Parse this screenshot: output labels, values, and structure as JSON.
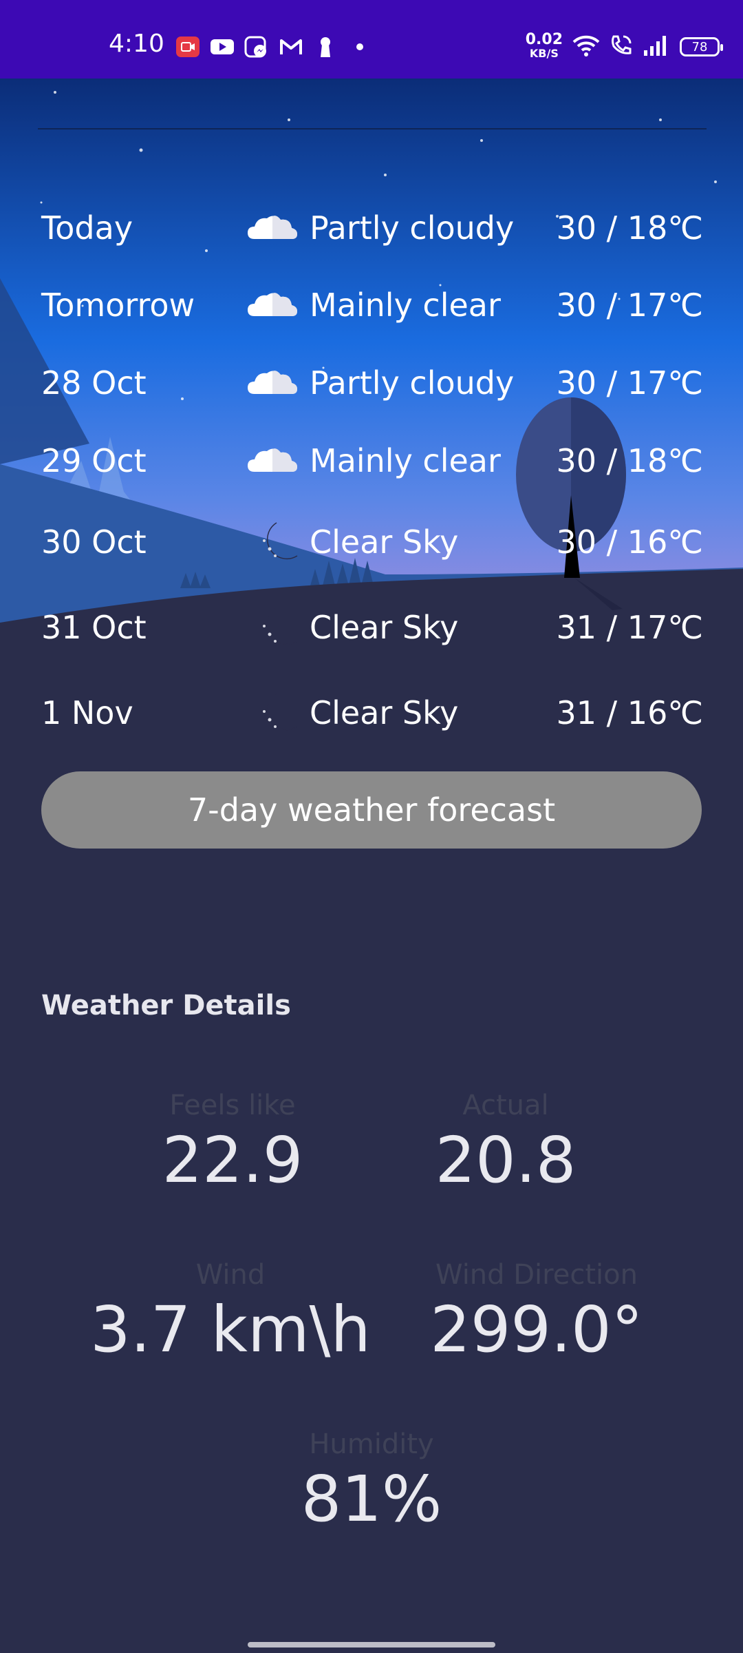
{
  "status_bar": {
    "time": "4:10",
    "net_speed_value": "0.02",
    "net_speed_unit": "KB/S",
    "battery": "78",
    "icons_left": [
      "screen-record-icon",
      "youtube-icon",
      "messenger-icon",
      "gmail-icon",
      "keyhole-icon",
      "dot-icon"
    ],
    "icons_right": [
      "wifi-icon",
      "wifi-calling-icon",
      "signal-icon",
      "battery-icon"
    ]
  },
  "forecast": {
    "rows": [
      {
        "day": "Today",
        "icon": "partly-cloudy-icon",
        "condition": "Partly cloudy",
        "temp": "30 / 18℃"
      },
      {
        "day": "Tomorrow",
        "icon": "partly-cloudy-icon",
        "condition": "Mainly clear",
        "temp": "30 / 17℃"
      },
      {
        "day": "28 Oct",
        "icon": "partly-cloudy-icon",
        "condition": "Partly cloudy",
        "temp": "30 / 17℃"
      },
      {
        "day": "29 Oct",
        "icon": "partly-cloudy-icon",
        "condition": "Mainly clear",
        "temp": "30 / 18℃"
      },
      {
        "day": "30 Oct",
        "icon": "crescent-moon-icon",
        "condition": "Clear Sky",
        "temp": "30 / 16℃"
      },
      {
        "day": "31 Oct",
        "icon": "crescent-moon-icon",
        "condition": "Clear Sky",
        "temp": "31 / 17℃"
      },
      {
        "day": "1 Nov",
        "icon": "crescent-moon-icon",
        "condition": "Clear Sky",
        "temp": "31 / 16℃"
      }
    ],
    "button_label": "7-day weather forecast"
  },
  "details": {
    "title": "Weather Details",
    "feels_like": {
      "label": "Feels like",
      "value": "22.9"
    },
    "actual": {
      "label": "Actual",
      "value": "20.8"
    },
    "wind": {
      "label": "Wind",
      "value": "3.7 km\\h"
    },
    "wind_direction": {
      "label": "Wind Direction",
      "value": "299.0°"
    },
    "humidity": {
      "label": "Humidity",
      "value": "81%"
    }
  },
  "colors": {
    "status_bar": "#3d09b4",
    "sky_top": "#0b2d78",
    "sky_mid": "#1a6ce0",
    "horizon": "#9a8ee0",
    "ground": "#2a2d4b",
    "button": "#8b8b8b"
  }
}
